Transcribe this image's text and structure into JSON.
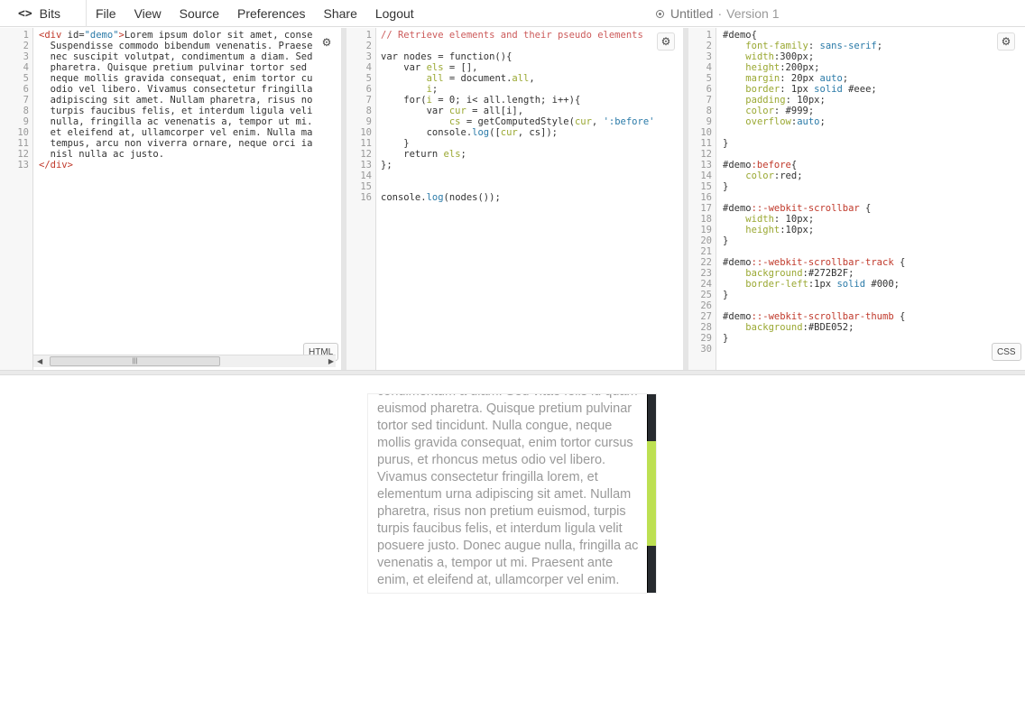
{
  "app": {
    "icon": "code-icon",
    "name": "Bits"
  },
  "menu": [
    "File",
    "View",
    "Source",
    "Preferences",
    "Share",
    "Logout"
  ],
  "document": {
    "title": "Untitled",
    "separator": "·",
    "version": "Version 1"
  },
  "html_pane": {
    "language_label": "HTML",
    "line_numbers": [
      "1",
      "2",
      "3",
      "4",
      "5",
      "6",
      "7",
      "8",
      "9",
      "10",
      "11",
      "12",
      "13"
    ],
    "lines": [
      "<div id=\"demo\">Lorem ipsum dolor sit amet, conse",
      "  Suspendisse commodo bibendum venenatis. Praese",
      "  nec suscipit volutpat, condimentum a diam. Sed",
      "  pharetra. Quisque pretium pulvinar tortor sed",
      "  neque mollis gravida consequat, enim tortor cu",
      "  odio vel libero. Vivamus consectetur fringilla",
      "  adipiscing sit amet. Nullam pharetra, risus no",
      "  turpis faucibus felis, et interdum ligula veli",
      "  nulla, fringilla ac venenatis a, tempor ut mi.",
      "  et eleifend at, ullamcorper vel enim. Nulla ma",
      "  tempus, arcu non viverra ornare, neque orci ia",
      "  nisl nulla ac justo.",
      "</div>"
    ]
  },
  "js_pane": {
    "line_numbers": [
      "1",
      "2",
      "3",
      "4",
      "5",
      "6",
      "7",
      "8",
      "9",
      "10",
      "11",
      "12",
      "13",
      "14",
      "15",
      "16"
    ],
    "lines": [
      "// Retrieve elements and their pseudo elements",
      "",
      "var nodes = function(){",
      "    var els = [],",
      "        all = document.all,",
      "        i;",
      "    for(i = 0; i< all.length; i++){",
      "        var cur = all[i],",
      "            cs = getComputedStyle(cur, ':before'",
      "        console.log([cur, cs]);",
      "    }",
      "    return els;",
      "};",
      "",
      "",
      "console.log(nodes());"
    ]
  },
  "css_pane": {
    "language_label": "CSS",
    "line_numbers": [
      "1",
      "2",
      "3",
      "4",
      "5",
      "6",
      "7",
      "8",
      "9",
      "10",
      "11",
      "12",
      "13",
      "14",
      "15",
      "16",
      "17",
      "18",
      "19",
      "20",
      "21",
      "22",
      "23",
      "24",
      "25",
      "26",
      "27",
      "28",
      "29",
      "30"
    ],
    "lines": [
      "#demo{",
      "    font-family: sans-serif;",
      "    width:300px;",
      "    height:200px;",
      "    margin: 20px auto;",
      "    border: 1px solid #eee;",
      "    padding: 10px;",
      "    color: #999;",
      "    overflow:auto;",
      "",
      "}",
      "",
      "#demo:before{",
      "    color:red;",
      "}",
      "",
      "#demo::-webkit-scrollbar {",
      "    width: 10px;",
      "    height:10px;",
      "}",
      "",
      "#demo::-webkit-scrollbar-track {",
      "    background:#272B2F;",
      "    border-left:1px solid #000;",
      "}",
      "",
      "#demo::-webkit-scrollbar-thumb {",
      "    background:#BDE052;",
      "}",
      ""
    ]
  },
  "preview": {
    "text": "condimentum a diam. Sed vitae felis id quam euismod pharetra. Quisque pretium pulvinar tortor sed tincidunt. Nulla congue, neque mollis gravida consequat, enim tortor cursus purus, et rhoncus metus odio vel libero. Vivamus consectetur fringilla lorem, et elementum urna adipiscing sit amet. Nullam pharetra, risus non pretium euismod, turpis turpis faucibus felis, et interdum ligula velit posuere justo. Donec augue nulla, fringilla ac venenatis a, tempor ut mi. Praesent ante enim, et eleifend at, ullamcorper vel enim.",
    "scrollbar_track_color": "#272B2F",
    "scrollbar_thumb_color": "#BDE052",
    "text_color": "#999999"
  },
  "icons": {
    "gear": "gear-icon",
    "scroll_left": "arrow-left-icon",
    "scroll_right": "arrow-right-icon"
  }
}
